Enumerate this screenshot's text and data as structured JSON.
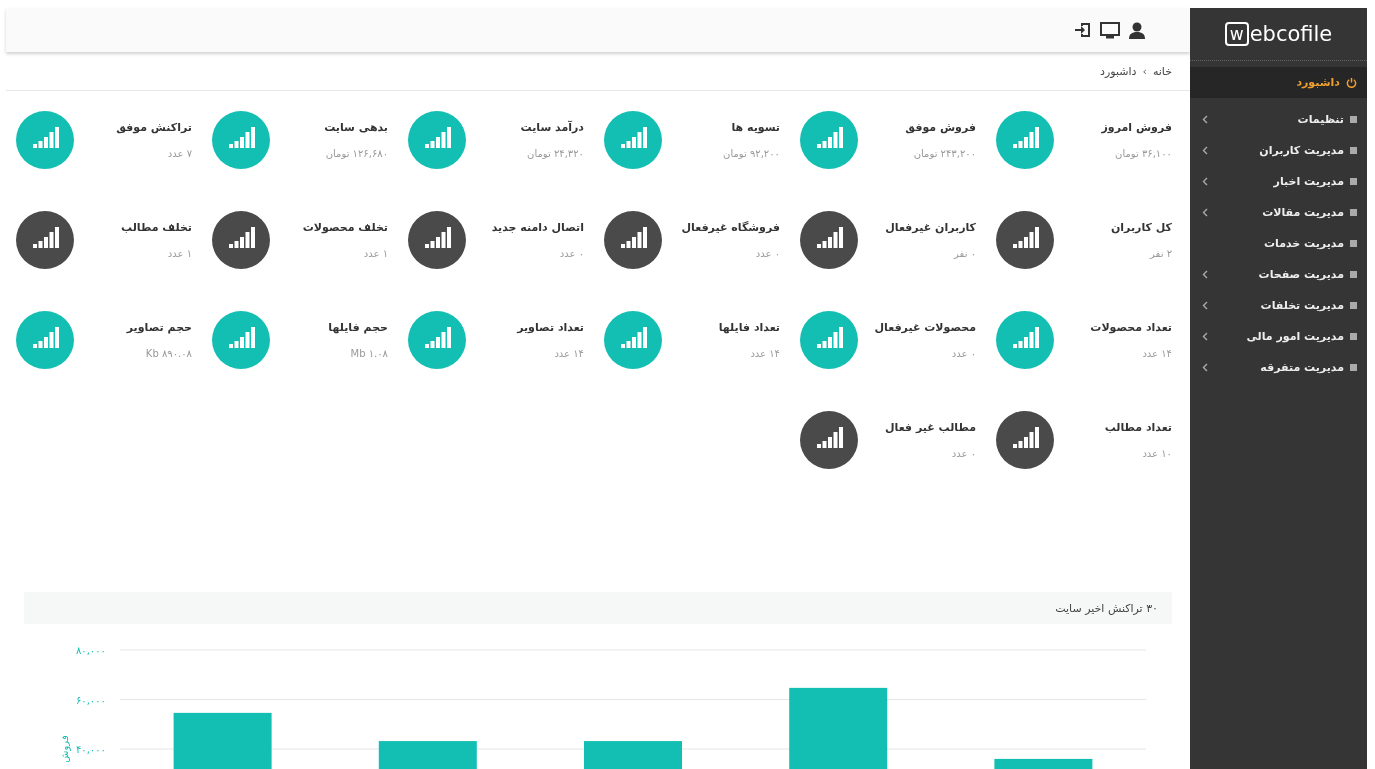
{
  "breadcrumb": {
    "items": [
      "خانه",
      "داشبورد"
    ],
    "separator": "›"
  },
  "stats": [
    {
      "title": "فروش امروز",
      "value": "۳۶,۱۰۰ تومان",
      "color": "#13bfb3"
    },
    {
      "title": "فروش موفق",
      "value": "۲۴۳,۲۰۰ تومان",
      "color": "#13bfb3"
    },
    {
      "title": "تسویه ها",
      "value": "۹۲,۲۰۰ تومان",
      "color": "#13bfb3"
    },
    {
      "title": "درآمد سایت",
      "value": "۲۴,۳۲۰ تومان",
      "color": "#13bfb3"
    },
    {
      "title": "بدهی سایت",
      "value": "۱۲۶,۶۸۰ تومان",
      "color": "#13bfb3"
    },
    {
      "title": "تراکنش موفق",
      "value": "۷ عدد",
      "color": "#13bfb3"
    },
    {
      "title": "کل کاربران",
      "value": "۲ نفر",
      "color": "#4a4a4a"
    },
    {
      "title": "کاربران غیرفعال",
      "value": "۰ نفر",
      "color": "#4a4a4a"
    },
    {
      "title": "فروشگاه غیرفعال",
      "value": "۰ عدد",
      "color": "#4a4a4a"
    },
    {
      "title": "اتصال دامنه جدید",
      "value": "۰ عدد",
      "color": "#4a4a4a"
    },
    {
      "title": "تخلف محصولات",
      "value": "۱ عدد",
      "color": "#4a4a4a"
    },
    {
      "title": "تخلف مطالب",
      "value": "۱ عدد",
      "color": "#4a4a4a"
    },
    {
      "title": "تعداد محصولات",
      "value": "۱۴ عدد",
      "color": "#13bfb3"
    },
    {
      "title": "محصولات غیرفعال",
      "value": "۰ عدد",
      "color": "#13bfb3"
    },
    {
      "title": "تعداد فایلها",
      "value": "۱۴ عدد",
      "color": "#13bfb3"
    },
    {
      "title": "تعداد تصاویر",
      "value": "۱۴ عدد",
      "color": "#13bfb3"
    },
    {
      "title": "حجم فایلها",
      "value": "۱.۰۸ Mb",
      "color": "#13bfb3"
    },
    {
      "title": "حجم تصاویر",
      "value": "۸۹۰.۰۸ Kb",
      "color": "#13bfb3"
    },
    {
      "title": "تعداد مطالب",
      "value": "۱۰ عدد",
      "color": "#4a4a4a"
    },
    {
      "title": "مطالب غیر فعال",
      "value": "۰ عدد",
      "color": "#4a4a4a"
    }
  ],
  "chart_panel": {
    "title": "۳۰ تراکنش اخیر سایت",
    "chart_data": {
      "type": "bar",
      "ylabel": "فروش",
      "series": [
        {
          "color": "#13bfb3",
          "values": [
            54600,
            43200,
            43200,
            64700,
            36000
          ]
        }
      ],
      "ylim": [
        32000,
        80000
      ],
      "yticks": [
        {
          "value": 40000,
          "label": "۴۰,۰۰۰"
        },
        {
          "value": 60000,
          "label": "۶۰,۰۰۰"
        },
        {
          "value": 80000,
          "label": "۸۰,۰۰۰"
        }
      ]
    }
  },
  "sidebar": {
    "logo": {
      "mark": "w",
      "text": "ebcofile"
    },
    "items": [
      {
        "label": "داشبورد",
        "selected": true,
        "expandable": false
      },
      {
        "label": "تنظیمات",
        "selected": false,
        "expandable": true
      },
      {
        "label": "مدیریت کاربران",
        "selected": false,
        "expandable": true
      },
      {
        "label": "مدیریت اخبار",
        "selected": false,
        "expandable": true
      },
      {
        "label": "مدیریت مقالات",
        "selected": false,
        "expandable": true
      },
      {
        "label": "مدیریت خدمات",
        "selected": false,
        "expandable": false
      },
      {
        "label": "مدیریت صفحات",
        "selected": false,
        "expandable": true
      },
      {
        "label": "مدیریت تخلفات",
        "selected": false,
        "expandable": true
      },
      {
        "label": "مدیریت امور مالی",
        "selected": false,
        "expandable": true
      },
      {
        "label": "مدیریت متفرقه",
        "selected": false,
        "expandable": true
      }
    ]
  }
}
